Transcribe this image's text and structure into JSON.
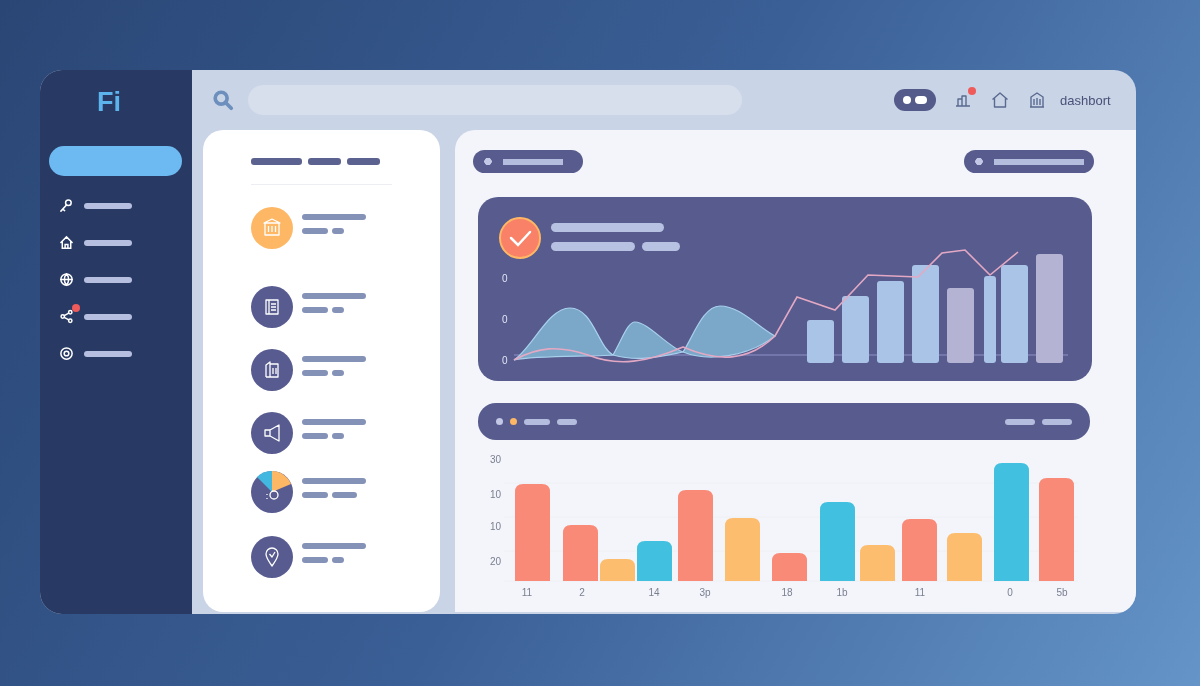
{
  "logo": "Fi",
  "sidebar": {
    "items": [
      {
        "notification": false
      },
      {
        "notification": false
      },
      {
        "notification": false
      },
      {
        "notification": true
      },
      {
        "notification": false
      }
    ]
  },
  "header": {
    "icons": [
      {
        "notification": true
      },
      {
        "notification": false
      },
      {
        "notification": false
      }
    ],
    "link": "dashbort"
  },
  "overview_chart": {
    "y_labels": [
      "0",
      "0",
      "0"
    ]
  },
  "bar_chart": {
    "y_labels": [
      "30",
      "10",
      "10",
      "20"
    ],
    "x_labels": [
      "11",
      "2",
      "14",
      "3p",
      "18",
      "1b",
      "11",
      "0",
      "5b"
    ]
  }
}
